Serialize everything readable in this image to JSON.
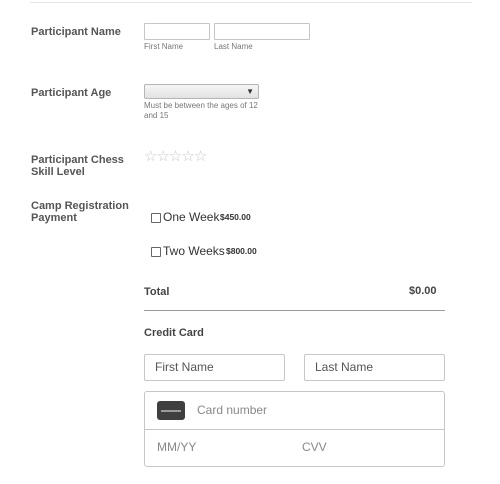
{
  "fields": {
    "participant_name": {
      "label": "Participant Name",
      "first_sub": "First Name",
      "last_sub": "Last Name"
    },
    "participant_age": {
      "label": "Participant Age",
      "selected": "",
      "hint": "Must be between the ages of 12 and 15",
      "icon": "chevron-down-icon"
    },
    "skill_level": {
      "label": "Participant Chess Skill Level",
      "rating": 0,
      "max": 5,
      "icon": "star-icon"
    },
    "payment": {
      "label": "Camp Registration Payment",
      "options": [
        {
          "name": "One Week",
          "price": "$450.00",
          "checked": false
        },
        {
          "name": "Two Weeks",
          "price": "$800.00",
          "checked": false
        }
      ]
    }
  },
  "total": {
    "label": "Total",
    "value": "$0.00"
  },
  "credit_card": {
    "title": "Credit Card",
    "first_placeholder": "First Name",
    "last_placeholder": "Last Name",
    "card_number_placeholder": "Card number",
    "expiry_placeholder": "MM/YY",
    "cvv_placeholder": "CVV",
    "card_icon": "credit-card-icon"
  },
  "colors": {
    "text": "#555555",
    "border": "#c6c6c6",
    "star": "#c9c9c9"
  }
}
